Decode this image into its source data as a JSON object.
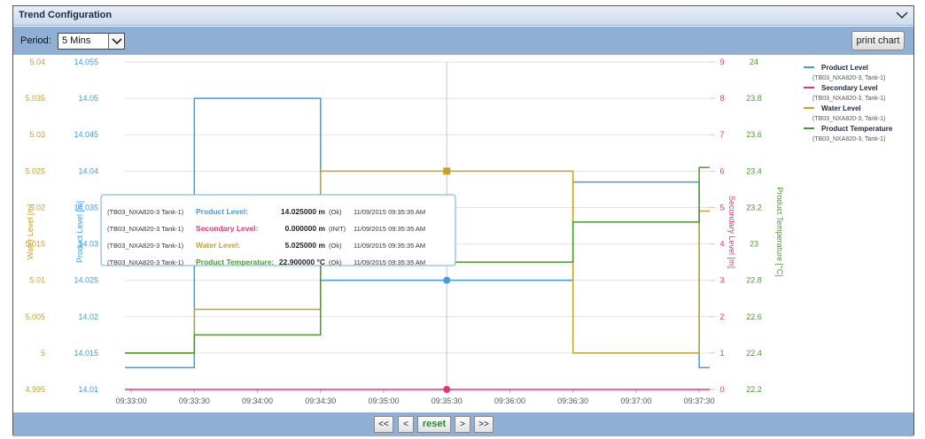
{
  "window": {
    "title": "Trend Configuration"
  },
  "toolbar": {
    "period_label": "Period:",
    "period_value": "5 Mins",
    "print_label": "print chart"
  },
  "nav": {
    "first": "<<",
    "prev": "<",
    "reset": "reset",
    "next": ">",
    "last": ">>"
  },
  "colors": {
    "product": "#3d9be9",
    "secondary": "#e8337a",
    "water": "#c9a02a",
    "temperature": "#4a9a2a"
  },
  "tooltip": {
    "rows": [
      {
        "tag": "(TB03_NXA820-3 Tank-1)",
        "name": "Product Level:",
        "value": "14.025000 m",
        "status": "(Ok)",
        "time": "11/09/2015 09:35:35 AM"
      },
      {
        "tag": "(TB03_NXA820-3 Tank-1)",
        "name": "Secondary Level:",
        "value": "0.000000 m",
        "status": "(INIT)",
        "time": "11/09/2015 09:35:35 AM"
      },
      {
        "tag": "(TB03_NXA820-3 Tank-1)",
        "name": "Water Level:",
        "value": "5.025000 m",
        "status": "(Ok)",
        "time": "11/09/2015 09:35:35 AM"
      },
      {
        "tag": "(TB03_NXA820-3 Tank-1)",
        "name": "Product Temperature:",
        "value": "22.900000 °C",
        "status": "(Ok)",
        "time": "11/09/2015 09:35:35 AM"
      }
    ]
  },
  "chart_data": {
    "type": "line",
    "step": true,
    "x_ticks": [
      "09:33:00",
      "09:33:30",
      "09:34:00",
      "09:34:30",
      "09:35:00",
      "09:35:30",
      "09:36:00",
      "09:36:30",
      "09:37:00",
      "09:37:30"
    ],
    "crosshair_x": "09:35:30",
    "axes": [
      {
        "id": "water",
        "title": "Water Level [m]",
        "side": "left",
        "range": [
          4.995,
          5.04
        ],
        "ticks": [
          "4.995",
          "5",
          "5.005",
          "5.01",
          "5.015",
          "5.02",
          "5.025",
          "5.03",
          "5.035",
          "5.04"
        ]
      },
      {
        "id": "product",
        "title": "Product Level [m]",
        "side": "left",
        "range": [
          14.01,
          14.055
        ],
        "ticks": [
          "14.01",
          "14.015",
          "14.02",
          "14.025",
          "14.03",
          "14.035",
          "14.04",
          "14.045",
          "14.05",
          "14.055"
        ]
      },
      {
        "id": "secondary",
        "title": "Secondary Level [m]",
        "side": "right",
        "range": [
          0,
          9
        ],
        "ticks": [
          "0",
          "1",
          "2",
          "3",
          "4",
          "5",
          "6",
          "7",
          "8",
          "9"
        ]
      },
      {
        "id": "temperature",
        "title": "Product Temperature [°C]",
        "side": "right",
        "range": [
          22.2,
          24
        ],
        "ticks": [
          "22.2",
          "22.4",
          "22.6",
          "22.8",
          "23",
          "23.2",
          "23.4",
          "23.6",
          "23.8",
          "24"
        ]
      }
    ],
    "legend_position": "right",
    "series": [
      {
        "name": "Product Level",
        "sub": "(TB03_NXA820-3, Tank-1)",
        "axis": "product",
        "x": [
          "09:32:57",
          "09:33:30",
          "09:34:30",
          "09:35:30",
          "09:36:30",
          "09:37:30",
          "09:37:35"
        ],
        "values": [
          14.013,
          14.05,
          14.025,
          14.025,
          14.0385,
          14.013,
          14.013
        ]
      },
      {
        "name": "Secondary Level",
        "sub": "(TB03_NXA820-3, Tank-1)",
        "axis": "secondary",
        "x": [
          "09:32:57",
          "09:37:35"
        ],
        "values": [
          0,
          0
        ]
      },
      {
        "name": "Water Level",
        "sub": "(TB03_NXA820-3, Tank-1)",
        "axis": "water",
        "x": [
          "09:32:57",
          "09:33:30",
          "09:34:30",
          "09:35:30",
          "09:36:30",
          "09:37:30",
          "09:37:35"
        ],
        "values": null
      },
      {
        "name": "Product Temperature",
        "sub": "(TB03_NXA820-3, Tank-1)",
        "axis": "temperature",
        "x": [
          "09:32:57",
          "09:33:30",
          "09:34:30",
          "09:35:30",
          "09:36:30",
          "09:37:30",
          "09:37:35"
        ],
        "values": [
          22.4,
          22.5,
          22.9,
          22.9,
          23.12,
          23.42,
          23.42
        ]
      }
    ],
    "water_values": [
      5.0,
      5.006,
      5.025,
      5.025,
      5.0,
      5.0195,
      5.0195
    ],
    "markers": [
      {
        "series": "Water Level",
        "x": "09:35:30",
        "value": 5.025,
        "shape": "square"
      },
      {
        "series": "Product Level",
        "x": "09:35:30",
        "value": 14.025,
        "shape": "circle"
      },
      {
        "series": "Secondary Level",
        "x": "09:35:30",
        "value": 0,
        "shape": "circle"
      }
    ]
  }
}
